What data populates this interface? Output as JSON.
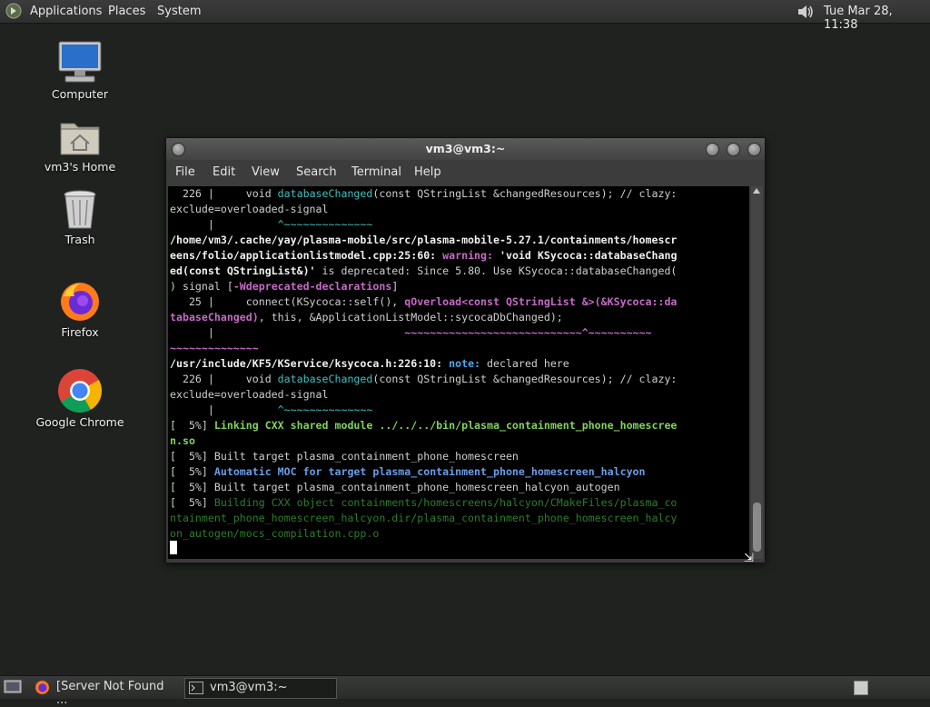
{
  "top_panel": {
    "menus": [
      "Applications",
      "Places",
      "System"
    ],
    "clock": "Tue Mar 28, 11:38"
  },
  "desktop": {
    "icons": [
      {
        "label": "Computer",
        "icon": "computer-icon"
      },
      {
        "label": "vm3's Home",
        "icon": "home-folder-icon"
      },
      {
        "label": "Trash",
        "icon": "trash-icon"
      },
      {
        "label": "Firefox",
        "icon": "firefox-icon"
      },
      {
        "label": "Google Chrome",
        "icon": "chrome-icon"
      }
    ]
  },
  "terminal": {
    "title": "vm3@vm3:~",
    "menu": [
      "File",
      "Edit",
      "View",
      "Search",
      "Terminal",
      "Help"
    ],
    "lines": [
      {
        "segs": [
          {
            "t": "  226 |     void ",
            "c": ""
          },
          {
            "t": "databaseChanged",
            "c": "c-cyan"
          },
          {
            "t": "(const QStringList &changedResources); // clazy:",
            "c": ""
          }
        ]
      },
      {
        "segs": [
          {
            "t": "exclude=overloaded-signal",
            "c": ""
          }
        ]
      },
      {
        "segs": [
          {
            "t": "      |          ",
            "c": ""
          },
          {
            "t": "^~~~~~~~~~~~~~~",
            "c": "c-cyan"
          }
        ]
      },
      {
        "segs": [
          {
            "t": "/home/vm3/.cache/yay/plasma-mobile/src/plasma-mobile-5.27.1/containments/homescr",
            "c": "c-bold"
          }
        ]
      },
      {
        "segs": [
          {
            "t": "eens/folio/applicationlistmodel.cpp:25:60: ",
            "c": "c-bold"
          },
          {
            "t": "warning: ",
            "c": "c-warn"
          },
          {
            "t": "'void KSycoca::databaseChang",
            "c": "c-bold"
          }
        ]
      },
      {
        "segs": [
          {
            "t": "ed(const QStringList&)'",
            "c": "c-bold"
          },
          {
            "t": " is deprecated: Since 5.80. Use KSycoca::databaseChanged(",
            "c": ""
          }
        ]
      },
      {
        "segs": [
          {
            "t": ") signal [",
            "c": ""
          },
          {
            "t": "-Wdeprecated-declarations",
            "c": "c-warn"
          },
          {
            "t": "]",
            "c": ""
          }
        ]
      },
      {
        "segs": [
          {
            "t": "   25 |     connect(KSycoca::self(), ",
            "c": ""
          },
          {
            "t": "qOverload<const QStringList &>(&KSycoca::da",
            "c": "c-warn"
          }
        ]
      },
      {
        "segs": [
          {
            "t": "tabaseChanged)",
            "c": "c-warn"
          },
          {
            "t": ", this, &ApplicationListModel::sycocaDbChanged);",
            "c": ""
          }
        ]
      },
      {
        "segs": [
          {
            "t": "      |                              ",
            "c": ""
          },
          {
            "t": "~~~~~~~~~~~~~~~~~~~~~~~~~~~~^~~~~~~~~~~",
            "c": "c-warn"
          }
        ]
      },
      {
        "segs": [
          {
            "t": "~~~~~~~~~~~~~~",
            "c": "c-warn"
          }
        ]
      },
      {
        "segs": [
          {
            "t": "/usr/include/KF5/KService/ksycoca.h:226:10: ",
            "c": "c-bold"
          },
          {
            "t": "note: ",
            "c": "c-note"
          },
          {
            "t": "declared here",
            "c": ""
          }
        ]
      },
      {
        "segs": [
          {
            "t": "  226 |     void ",
            "c": ""
          },
          {
            "t": "databaseChanged",
            "c": "c-cyan"
          },
          {
            "t": "(const QStringList &changedResources); // clazy:",
            "c": ""
          }
        ]
      },
      {
        "segs": [
          {
            "t": "exclude=overloaded-signal",
            "c": ""
          }
        ]
      },
      {
        "segs": [
          {
            "t": "      |          ",
            "c": ""
          },
          {
            "t": "^~~~~~~~~~~~~~~",
            "c": "c-cyan"
          }
        ]
      },
      {
        "segs": [
          {
            "t": "[  5%] ",
            "c": ""
          },
          {
            "t": "Linking CXX shared module ../../../bin/plasma_containment_phone_homescree",
            "c": "c-green"
          }
        ]
      },
      {
        "segs": [
          {
            "t": "n.so",
            "c": "c-green"
          }
        ]
      },
      {
        "segs": [
          {
            "t": "[  5%] Built target plasma_containment_phone_homescreen",
            "c": ""
          }
        ]
      },
      {
        "segs": [
          {
            "t": "[  5%] ",
            "c": ""
          },
          {
            "t": "Automatic MOC for target plasma_containment_phone_homescreen_halcyon",
            "c": "c-blue"
          }
        ]
      },
      {
        "segs": [
          {
            "t": "[  5%] Built target plasma_containment_phone_homescreen_halcyon_autogen",
            "c": ""
          }
        ]
      },
      {
        "segs": [
          {
            "t": "[  5%] ",
            "c": ""
          },
          {
            "t": "Building CXX object containments/homescreens/halcyon/CMakeFiles/plasma_co",
            "c": "c-dim"
          }
        ]
      },
      {
        "segs": [
          {
            "t": "ntainment_phone_homescreen_halcyon.dir/plasma_containment_phone_homescreen_halcy",
            "c": "c-dim"
          }
        ]
      },
      {
        "segs": [
          {
            "t": "on_autogen/mocs_compilation.cpp.o",
            "c": "c-dim"
          }
        ]
      }
    ]
  },
  "taskbar": {
    "tasks": [
      {
        "label": "[Server Not Found ...",
        "icon": "firefox-icon",
        "active": false
      },
      {
        "label": "vm3@vm3:~",
        "icon": "terminal-icon",
        "active": true
      }
    ]
  },
  "colors": {
    "desktop_bg": "#1f221f",
    "cyan": "#3fc0c0",
    "magenta": "#c66ac6",
    "green": "#7fd35c",
    "blue": "#6a9ee8"
  }
}
